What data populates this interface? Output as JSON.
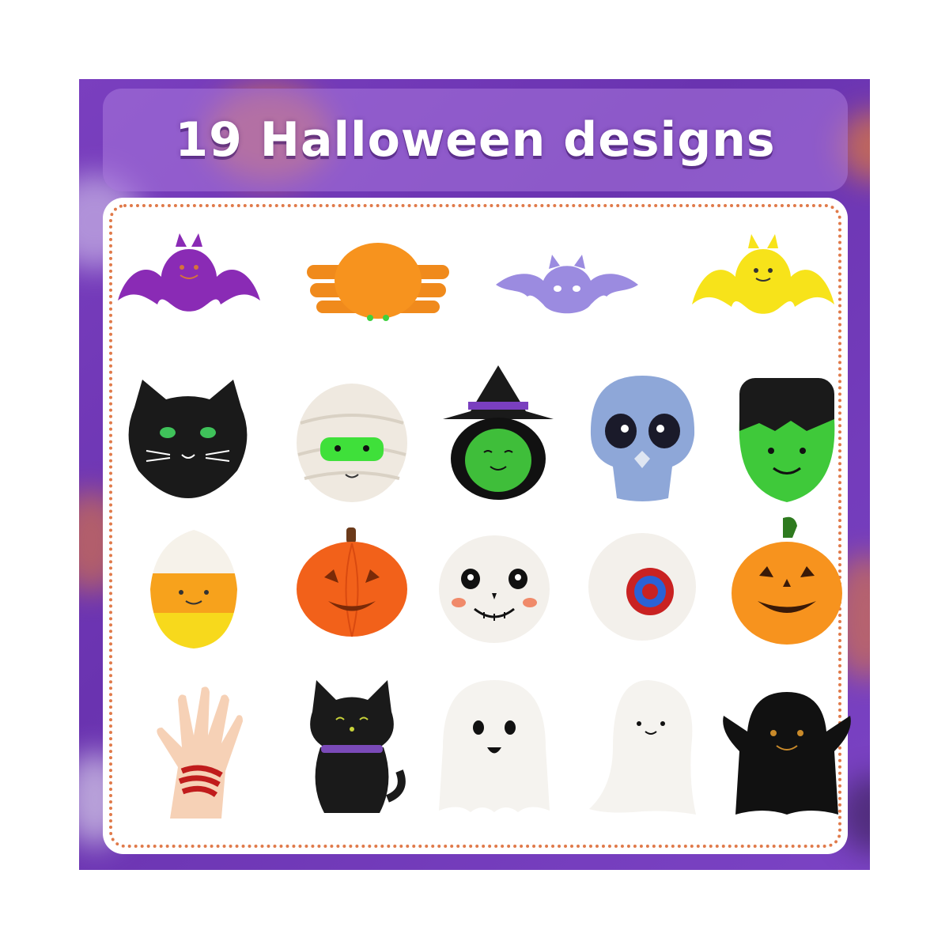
{
  "banner": {
    "title": "19 Halloween designs"
  },
  "toys": [
    "purple-bat",
    "orange-spider",
    "lavender-bat",
    "yellow-bat",
    "black-cat-face",
    "mummy",
    "witch",
    "blue-skull",
    "frankenstein",
    "candy-corn",
    "orange-pumpkin",
    "white-skull",
    "eyeball",
    "jack-o-lantern",
    "zombie-hand",
    "black-cat-sitting",
    "white-ghost",
    "white-ghost-slim",
    "black-ghost"
  ],
  "colors": {
    "background": "#6a33b0",
    "card": "#ffffff",
    "dotted_border": "#e07a4a",
    "title": "#ffffff"
  }
}
